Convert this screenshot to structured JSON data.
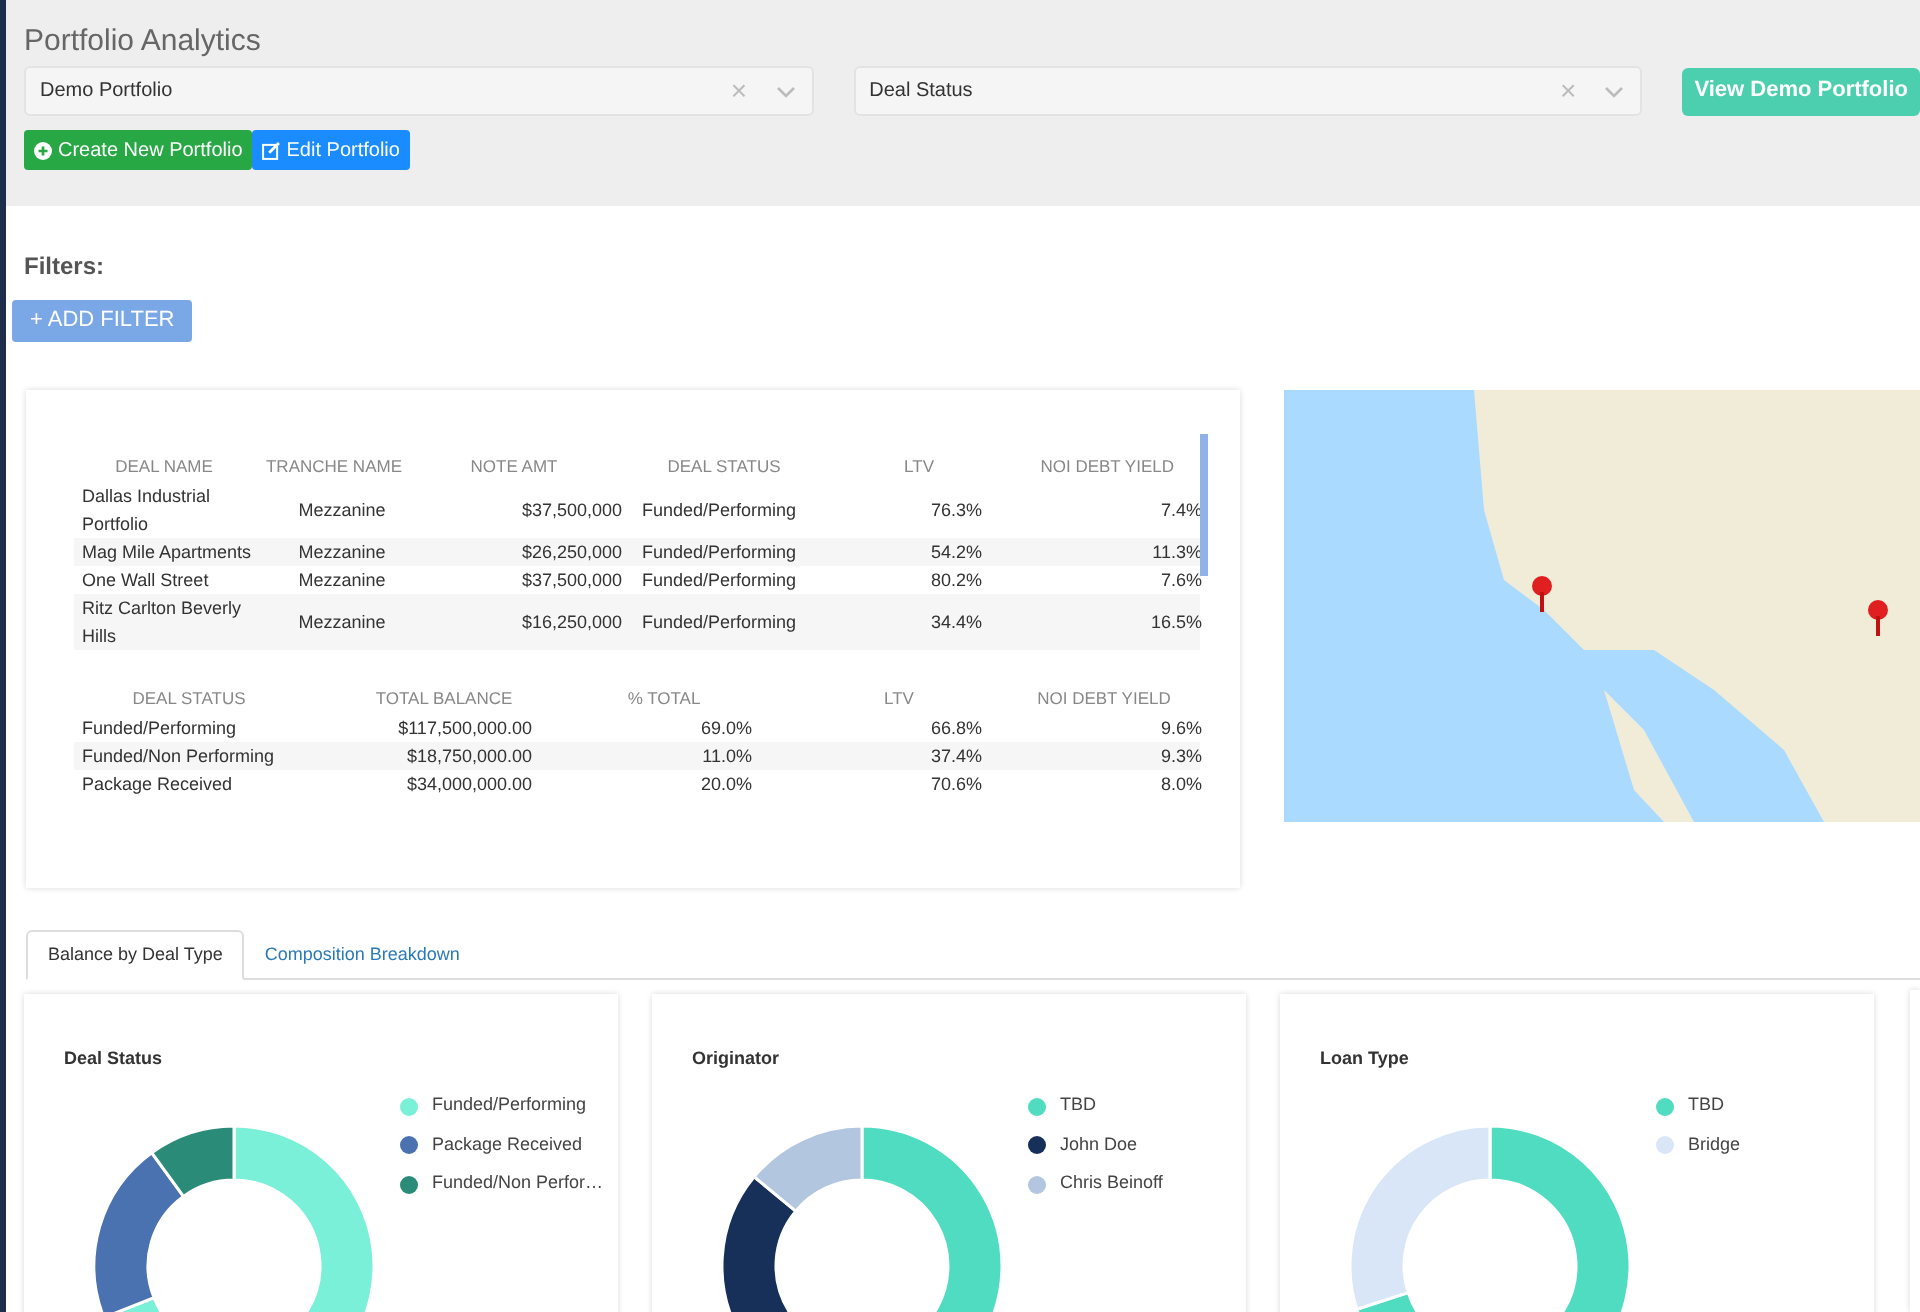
{
  "header": {
    "title": "Portfolio Analytics",
    "selects": [
      {
        "value": "Demo Portfolio",
        "clear": "×"
      },
      {
        "value": "Deal Status",
        "clear": "×"
      }
    ],
    "view_button": "View Demo Portfolio",
    "buttons": [
      {
        "kind": "create",
        "label": "Create New Portfolio"
      },
      {
        "kind": "edit",
        "label": "Edit Portfolio"
      }
    ]
  },
  "filters": {
    "label": "Filters:",
    "add_button": "+ ADD FILTER"
  },
  "deals_table": {
    "columns": [
      "DEAL NAME",
      "TRANCHE NAME",
      "NOTE AMT",
      "DEAL STATUS",
      "LTV",
      "NOI DEBT YIELD"
    ],
    "rows": [
      [
        "Dallas Industrial Portfolio",
        "Mezzanine",
        "$37,500,000",
        "Funded/Performing",
        "76.3%",
        "7.4%"
      ],
      [
        "Mag Mile Apartments",
        "Mezzanine",
        "$26,250,000",
        "Funded/Performing",
        "54.2%",
        "11.3%"
      ],
      [
        "One Wall Street",
        "Mezzanine",
        "$37,500,000",
        "Funded/Performing",
        "80.2%",
        "7.6%"
      ],
      [
        "Ritz Carlton Beverly Hills",
        "Mezzanine",
        "$16,250,000",
        "Funded/Performing",
        "34.4%",
        "16.5%"
      ]
    ]
  },
  "summary_table": {
    "columns": [
      "DEAL STATUS",
      "TOTAL BALANCE",
      "% TOTAL",
      "LTV",
      "NOI DEBT YIELD"
    ],
    "rows": [
      [
        "Funded/Performing",
        "$117,500,000.00",
        "69.0%",
        "66.8%",
        "9.6%"
      ],
      [
        "Funded/Non Performing",
        "$18,750,000.00",
        "11.0%",
        "37.4%",
        "9.3%"
      ],
      [
        "Package Received",
        "$34,000,000.00",
        "20.0%",
        "70.6%",
        "8.0%"
      ]
    ]
  },
  "tabs": [
    {
      "label": "Balance by Deal Type",
      "selected": true
    },
    {
      "label": "Composition Breakdown",
      "selected": false
    }
  ],
  "cards": [
    {
      "title": "Deal Status",
      "legend": [
        {
          "label": "Funded/Performing",
          "color": "#7af0d8"
        },
        {
          "label": "Package Received",
          "color": "#4a72b0"
        },
        {
          "label": "Funded/Non Perfor…",
          "color": "#2a8c78"
        }
      ]
    },
    {
      "title": "Originator",
      "legend": [
        {
          "label": "TBD",
          "color": "#4fdcc0"
        },
        {
          "label": "John Doe",
          "color": "#17305a"
        },
        {
          "label": "Chris Beinoff",
          "color": "#b2c6e0"
        }
      ]
    },
    {
      "title": "Loan Type",
      "legend": [
        {
          "label": "TBD",
          "color": "#4fdcc0"
        },
        {
          "label": "Bridge",
          "color": "#d8e6f8"
        }
      ]
    }
  ]
}
